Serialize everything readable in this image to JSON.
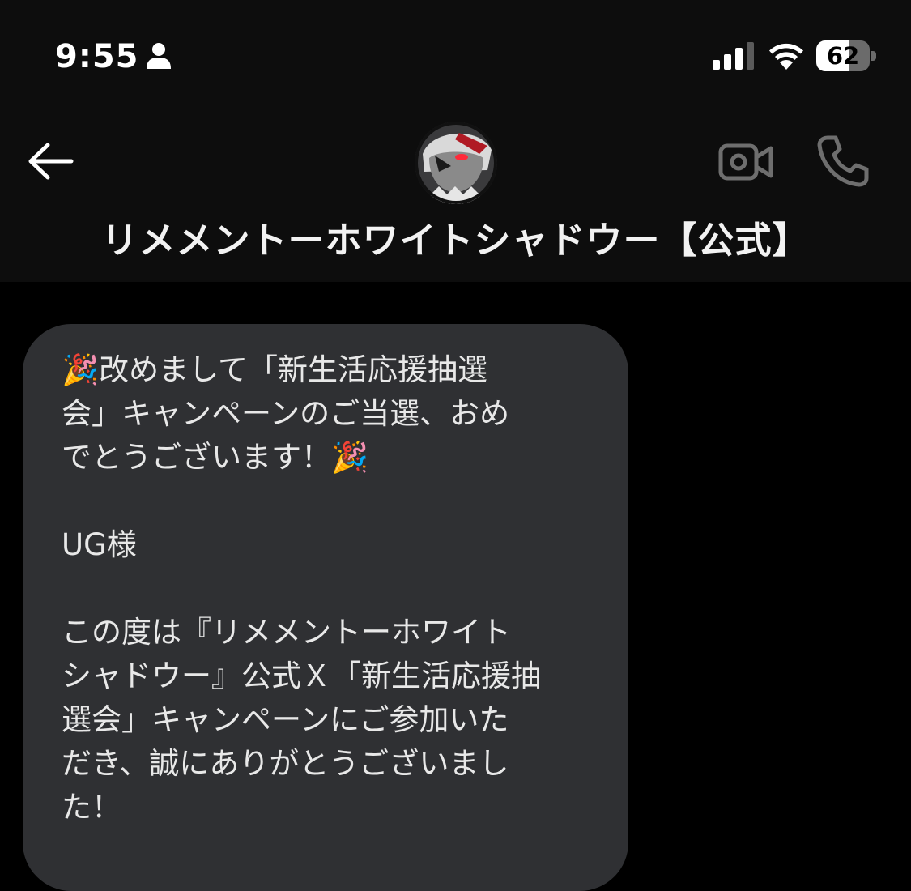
{
  "status_bar": {
    "time": "9:55",
    "battery_level": "62",
    "icons": [
      "person-icon",
      "signal-icon",
      "wifi-icon",
      "battery-icon"
    ]
  },
  "header": {
    "contact_name": "リメメントーホワイトシャドウー【公式】",
    "icons": [
      "back-arrow-icon",
      "video-call-icon",
      "phone-call-icon"
    ]
  },
  "colors": {
    "background": "#000000",
    "header_background": "#0d0d0d",
    "bubble_background": "#2f3033",
    "text": "#e8e8e8",
    "icon_gray": "#6e6e6e",
    "avatar_accent": "#d41c2a"
  },
  "message": {
    "text": "🎉改めまして「新生活応援抽選\n会」キャンペーンのご当選、おめ\nでとうございます！🎉\n\nUG様\n\nこの度は『リメメントーホワイト\nシャドウー』公式Ｘ「新生活応援抽\n選会」キャンペーンにご参加いた\nだき、誠にありがとうございまし\nた！"
  }
}
